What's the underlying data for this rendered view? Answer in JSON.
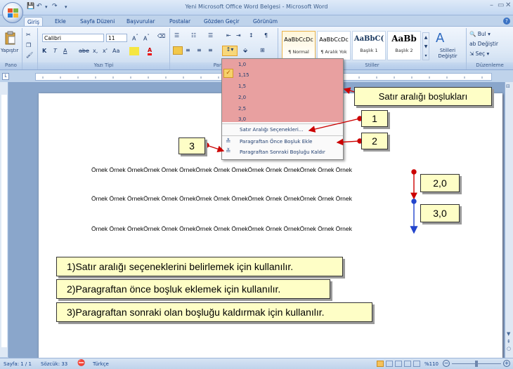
{
  "window": {
    "title": "Yeni Microsoft Office Word Belgesi - Microsoft Word",
    "controls": [
      "–",
      "▭",
      "✕"
    ]
  },
  "tabs": [
    "Giriş",
    "Ekle",
    "Sayfa Düzeni",
    "Başvurular",
    "Postalar",
    "Gözden Geçir",
    "Görünüm"
  ],
  "ribbon": {
    "clipboard": {
      "paste_label": "Yapıştır",
      "group": "Pano"
    },
    "font": {
      "name": "Calibri",
      "size": "11",
      "group": "Yazı Tipi"
    },
    "paragraph": {
      "group": "Paragraf"
    },
    "styles": {
      "items": [
        {
          "preview": "AaBbCcDc",
          "name": "¶ Normal"
        },
        {
          "preview": "AaBbCcDc",
          "name": "¶ Aralık Yok"
        },
        {
          "preview": "AaBbC(",
          "name": "Başlık 1"
        },
        {
          "preview": "AaBb",
          "name": "Başlık 2"
        }
      ],
      "change_label": "Stilleri Değiştir",
      "group": "Stiller"
    },
    "editing": {
      "find": "Bul",
      "replace": "Değiştir",
      "select": "Seç",
      "group": "Düzenleme"
    }
  },
  "line_spacing_menu": {
    "values": [
      "1,0",
      "1,15",
      "1,5",
      "2,0",
      "2,5",
      "3,0"
    ],
    "selected": "1,15",
    "options_item": "Satır Aralığı Seçenekleri...",
    "add_before": "Paragraftan Önce Boşluk Ekle",
    "remove_after": "Paragraftan Sonraki Boşluğu Kaldır"
  },
  "document": {
    "line": "Örnek Örnek ÖrnekÖrnek Örnek ÖrnekÖrnek Örnek ÖrnekÖrnek Örnek ÖrnekÖrnek Örnek Örnek"
  },
  "callouts": {
    "header": "Satır aralığı boşlukları",
    "n1": "1",
    "n2": "2",
    "n3": "3",
    "v20": "2,0",
    "v30": "3,0",
    "exp1": "1)Satır aralığı seçeneklerini belirlemek için kullanılır.",
    "exp2": "2)Paragraftan önce boşluk eklemek için kullanılır.",
    "exp3": "3)Paragraftan sonraki olan boşluğu kaldırmak için kullanılır."
  },
  "status": {
    "page": "Sayfa: 1 / 1",
    "words": "Sözcük: 33",
    "language": "Türkçe",
    "zoom": "%110"
  },
  "colors": {
    "ribbon": "#dce8f6",
    "menu_highlight": "#e8a0a0",
    "callout": "#fefec6",
    "arrow": "#cc0000"
  }
}
